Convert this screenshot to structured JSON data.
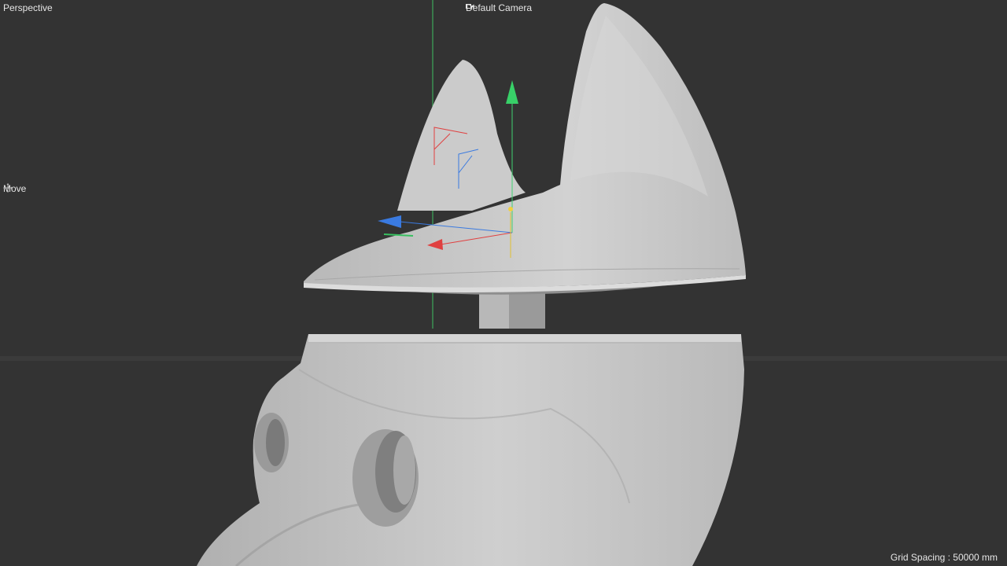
{
  "viewport": {
    "projection_label": "Perspective",
    "camera_label": "Default Camera",
    "camera_icon": "camera-icon",
    "active_tool_label": "Move",
    "active_tool_icon": "move-cross-icon",
    "grid_spacing_label": "Grid Spacing : 50000 mm",
    "background_color": "#333333",
    "model_color": "#c8c8c8",
    "axis_colors": {
      "x": "#e04040",
      "y": "#38d068",
      "z": "#3a7ae0"
    }
  }
}
